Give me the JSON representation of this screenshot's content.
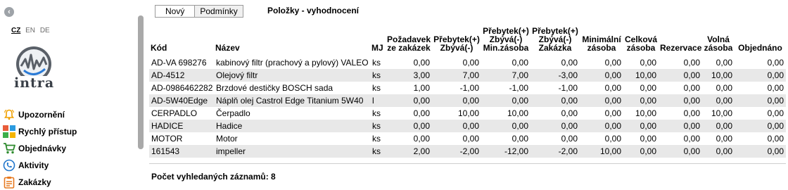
{
  "sidebar": {
    "languages": [
      {
        "code": "CZ",
        "active": true
      },
      {
        "code": "EN",
        "active": false
      },
      {
        "code": "DE",
        "active": false
      }
    ],
    "logo_text": "intra",
    "menu": [
      {
        "label": "Upozornění",
        "icon": "bell-icon"
      },
      {
        "label": "Rychlý přístup",
        "icon": "tiles-icon"
      },
      {
        "label": "Objednávky",
        "icon": "cart-icon"
      },
      {
        "label": "Aktivity",
        "icon": "phone-icon"
      },
      {
        "label": "Zakázky",
        "icon": "clipboard-icon"
      }
    ]
  },
  "tabs": [
    {
      "label": "Nový",
      "active": true
    },
    {
      "label": "Podmínky",
      "active": false
    }
  ],
  "page_title": "Položky - vyhodnocení",
  "table": {
    "headers": {
      "kod": "Kód",
      "nazev": "Název",
      "mj": "MJ",
      "pozadavek": "Požadavek ze zakázek",
      "prebytek": "Přebytek(+) Zbývá(-)",
      "prebytek_min": "Přebytek(+) Zbývá(-) Min.zásoba",
      "prebytek_zak": "Přebytek(+) Zbývá(-) Zakázka",
      "minimalni": "Minimální zásoba",
      "celkova": "Celková zásoba",
      "rezervace": "Rezervace",
      "volna": "Volná zásoba",
      "objednano": "Objednáno"
    },
    "rows": [
      {
        "kod": "AD-VA 698276",
        "nazev": "kabinový filtr (prachový a pylový) VALEO",
        "mj": "ks",
        "pozadavek": "0,00",
        "prebytek": "0,00",
        "prebytek_min": "0,00",
        "prebytek_zak": "0,00",
        "minimalni": "0,00",
        "celkova": "0,00",
        "rezervace": "0,00",
        "volna": "0,00",
        "objednano": "0,00"
      },
      {
        "kod": "AD-4512",
        "nazev": "Olejový filtr",
        "mj": "ks",
        "pozadavek": "3,00",
        "prebytek": "7,00",
        "prebytek_min": "7,00",
        "prebytek_zak": "-3,00",
        "minimalni": "0,00",
        "celkova": "10,00",
        "rezervace": "0,00",
        "volna": "10,00",
        "objednano": "0,00"
      },
      {
        "kod": "AD-0986462282",
        "nazev": "Brzdové destičky BOSCH sada",
        "mj": "ks",
        "pozadavek": "1,00",
        "prebytek": "-1,00",
        "prebytek_min": "-1,00",
        "prebytek_zak": "-1,00",
        "minimalni": "0,00",
        "celkova": "0,00",
        "rezervace": "0,00",
        "volna": "0,00",
        "objednano": "0,00"
      },
      {
        "kod": "AD-5W40Edge",
        "nazev": "Náplň olej Castrol Edge Titanium 5W40",
        "mj": "l",
        "pozadavek": "0,00",
        "prebytek": "0,00",
        "prebytek_min": "0,00",
        "prebytek_zak": "0,00",
        "minimalni": "0,00",
        "celkova": "0,00",
        "rezervace": "0,00",
        "volna": "0,00",
        "objednano": "0,00"
      },
      {
        "kod": "CERPADLO",
        "nazev": "Čerpadlo",
        "mj": "ks",
        "pozadavek": "0,00",
        "prebytek": "10,00",
        "prebytek_min": "10,00",
        "prebytek_zak": "0,00",
        "minimalni": "0,00",
        "celkova": "10,00",
        "rezervace": "0,00",
        "volna": "10,00",
        "objednano": "0,00"
      },
      {
        "kod": "HADICE",
        "nazev": "Hadice",
        "mj": "ks",
        "pozadavek": "0,00",
        "prebytek": "0,00",
        "prebytek_min": "0,00",
        "prebytek_zak": "0,00",
        "minimalni": "0,00",
        "celkova": "0,00",
        "rezervace": "0,00",
        "volna": "0,00",
        "objednano": "0,00"
      },
      {
        "kod": "MOTOR",
        "nazev": "Motor",
        "mj": "ks",
        "pozadavek": "0,00",
        "prebytek": "0,00",
        "prebytek_min": "0,00",
        "prebytek_zak": "0,00",
        "minimalni": "0,00",
        "celkova": "0,00",
        "rezervace": "0,00",
        "volna": "0,00",
        "objednano": "0,00"
      },
      {
        "kod": "161543",
        "nazev": "impeller",
        "mj": "ks",
        "pozadavek": "2,00",
        "prebytek": "-2,00",
        "prebytek_min": "-12,00",
        "prebytek_zak": "-2,00",
        "minimalni": "10,00",
        "celkova": "0,00",
        "rezervace": "0,00",
        "volna": "0,00",
        "objednano": "0,00"
      }
    ]
  },
  "footer": {
    "record_count": "Počet vyhledaných záznamů: 8"
  },
  "colors": {
    "row_stripe": "#e8e8e8",
    "bell_icon": "#f0a000",
    "cart_icon": "#2e8b2e",
    "phone_icon": "#2277cc",
    "clipboard_icon": "#e6781e"
  }
}
